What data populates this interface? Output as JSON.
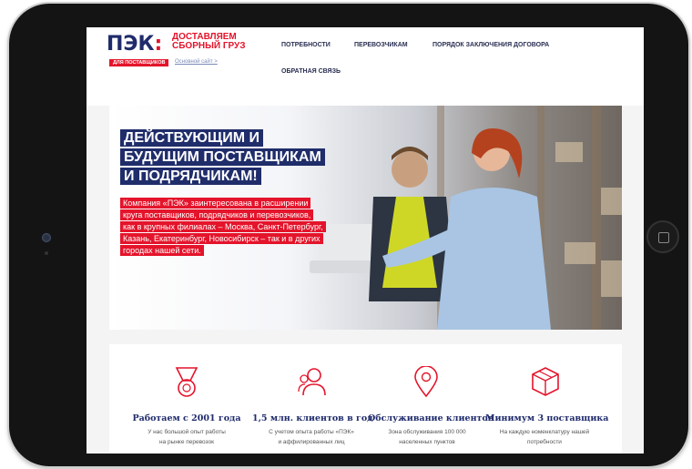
{
  "logo": {
    "brand": "ПЭК",
    "tagline_line1": "ДОСТАВЛЯЕМ",
    "tagline_line2": "СБОРНЫЙ ГРУЗ",
    "badge": "ДЛЯ ПОСТАВЩИКОВ",
    "main_site_link": "Основной сайт >"
  },
  "nav": [
    {
      "label": "ПОТРЕБНОСТИ"
    },
    {
      "label": "ПЕРЕВОЗЧИКАМ"
    },
    {
      "label": "ПОРЯДОК ЗАКЛЮЧЕНИЯ ДОГОВОРА"
    },
    {
      "label": "ОБРАТНАЯ СВЯЗЬ"
    }
  ],
  "hero": {
    "title_lines": [
      "ДЕЙСТВУЮЩИМ И",
      "БУДУЩИМ ПОСТАВЩИКАМ",
      "И ПОДРЯДЧИКАМ!"
    ],
    "text_lines": [
      "Компания «ПЭК» заинтересована в расширении",
      "круга поставщиков, подрядчиков и перевозчиков,",
      "как в крупных филиалах – Москва, Санкт-Петербург,",
      "Казань, Екатеринбург, Новосибирск – так и в других",
      "городах нашей сети."
    ]
  },
  "features": [
    {
      "icon": "medal-icon",
      "title": "Работаем с 2001 года",
      "desc_line1": "У нас большой опыт работы",
      "desc_line2": "на рынке перевозок"
    },
    {
      "icon": "clients-icon",
      "title": "1,5 млн. клиентов в год",
      "desc_line1": "С учетом опыта работы «ПЭК»",
      "desc_line2": "и аффилированных лиц"
    },
    {
      "icon": "location-pin-icon",
      "title": "Обслуживание клиентов",
      "desc_line1": "Зона обслуживания 100 000",
      "desc_line2": "населенных пунктов"
    },
    {
      "icon": "package-icon",
      "title": "Минимум 3 поставщика",
      "desc_line1": "На каждую номенклатуру нашей",
      "desc_line2": "потребности"
    }
  ],
  "colors": {
    "brand_blue": "#1f2b6b",
    "brand_red": "#e4142b",
    "icon_red": "#e4142b"
  }
}
